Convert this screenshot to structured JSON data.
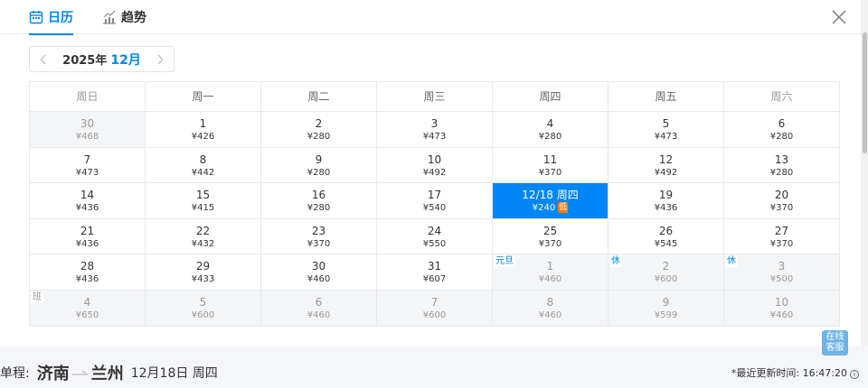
{
  "tabs": {
    "calendar": "日历",
    "trend": "趋势"
  },
  "month_nav": {
    "year": "2025年",
    "month": "12月"
  },
  "weekdays": [
    "周日",
    "周一",
    "周二",
    "周三",
    "周四",
    "周五",
    "周六"
  ],
  "weeks": [
    [
      {
        "day": "30",
        "price": "¥468",
        "other": true
      },
      {
        "day": "1",
        "price": "¥426"
      },
      {
        "day": "2",
        "price": "¥280"
      },
      {
        "day": "3",
        "price": "¥473"
      },
      {
        "day": "4",
        "price": "¥280"
      },
      {
        "day": "5",
        "price": "¥473"
      },
      {
        "day": "6",
        "price": "¥280"
      }
    ],
    [
      {
        "day": "7",
        "price": "¥473"
      },
      {
        "day": "8",
        "price": "¥442"
      },
      {
        "day": "9",
        "price": "¥280"
      },
      {
        "day": "10",
        "price": "¥492"
      },
      {
        "day": "11",
        "price": "¥370"
      },
      {
        "day": "12",
        "price": "¥492"
      },
      {
        "day": "13",
        "price": "¥280"
      }
    ],
    [
      {
        "day": "14",
        "price": "¥436"
      },
      {
        "day": "15",
        "price": "¥415"
      },
      {
        "day": "16",
        "price": "¥280"
      },
      {
        "day": "17",
        "price": "¥540"
      },
      {
        "day": "12/18 周四",
        "price": "¥240",
        "selected": true,
        "tag": "低"
      },
      {
        "day": "19",
        "price": "¥436"
      },
      {
        "day": "20",
        "price": "¥370"
      }
    ],
    [
      {
        "day": "21",
        "price": "¥436"
      },
      {
        "day": "22",
        "price": "¥432"
      },
      {
        "day": "23",
        "price": "¥370"
      },
      {
        "day": "24",
        "price": "¥550"
      },
      {
        "day": "25",
        "price": "¥370"
      },
      {
        "day": "26",
        "price": "¥545"
      },
      {
        "day": "27",
        "price": "¥370"
      }
    ],
    [
      {
        "day": "28",
        "price": "¥436"
      },
      {
        "day": "29",
        "price": "¥433"
      },
      {
        "day": "30",
        "price": "¥460"
      },
      {
        "day": "31",
        "price": "¥607"
      },
      {
        "day": "1",
        "price": "¥460",
        "other": true,
        "holiday": "元旦"
      },
      {
        "day": "2",
        "price": "¥600",
        "other": true,
        "holiday": "休"
      },
      {
        "day": "3",
        "price": "¥500",
        "other": true,
        "holiday": "休"
      }
    ],
    [
      {
        "day": "4",
        "price": "¥650",
        "other": true,
        "holiday": "班",
        "ban": true
      },
      {
        "day": "5",
        "price": "¥600",
        "other": true
      },
      {
        "day": "6",
        "price": "¥460",
        "other": true
      },
      {
        "day": "7",
        "price": "¥600",
        "other": true
      },
      {
        "day": "8",
        "price": "¥460",
        "other": true
      },
      {
        "day": "9",
        "price": "¥599",
        "other": true
      },
      {
        "day": "10",
        "price": "¥460",
        "other": true
      }
    ]
  ],
  "service": {
    "line1": "在线",
    "line2": "客服"
  },
  "trip": {
    "label": "单程:",
    "from": "济南",
    "to": "兰州",
    "date": "12月18日 周四"
  },
  "update": {
    "text": "*最近更新时间: 16:47:20",
    "info_icon": "i"
  },
  "colors": {
    "accent": "#0086f6",
    "low_tag": "#ff7d13"
  }
}
